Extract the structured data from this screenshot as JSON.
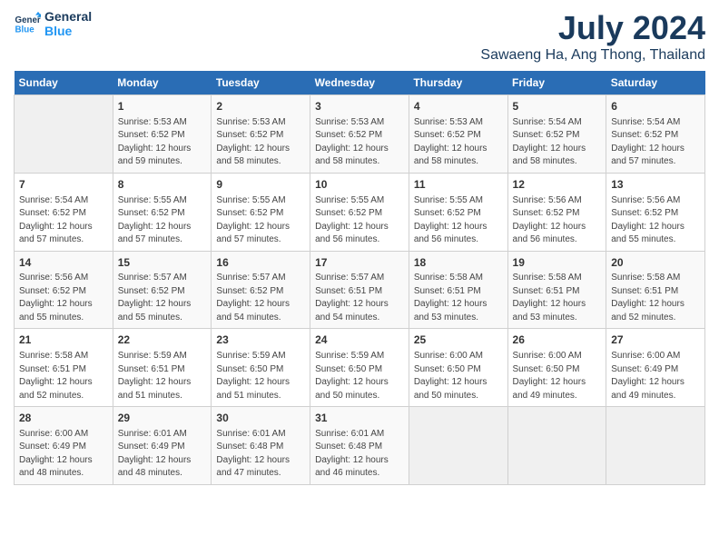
{
  "header": {
    "logo_line1": "General",
    "logo_line2": "Blue",
    "month_year": "July 2024",
    "location": "Sawaeng Ha, Ang Thong, Thailand"
  },
  "days_of_week": [
    "Sunday",
    "Monday",
    "Tuesday",
    "Wednesday",
    "Thursday",
    "Friday",
    "Saturday"
  ],
  "weeks": [
    [
      {
        "day": "",
        "info": ""
      },
      {
        "day": "1",
        "info": "Sunrise: 5:53 AM\nSunset: 6:52 PM\nDaylight: 12 hours\nand 59 minutes."
      },
      {
        "day": "2",
        "info": "Sunrise: 5:53 AM\nSunset: 6:52 PM\nDaylight: 12 hours\nand 58 minutes."
      },
      {
        "day": "3",
        "info": "Sunrise: 5:53 AM\nSunset: 6:52 PM\nDaylight: 12 hours\nand 58 minutes."
      },
      {
        "day": "4",
        "info": "Sunrise: 5:53 AM\nSunset: 6:52 PM\nDaylight: 12 hours\nand 58 minutes."
      },
      {
        "day": "5",
        "info": "Sunrise: 5:54 AM\nSunset: 6:52 PM\nDaylight: 12 hours\nand 58 minutes."
      },
      {
        "day": "6",
        "info": "Sunrise: 5:54 AM\nSunset: 6:52 PM\nDaylight: 12 hours\nand 57 minutes."
      }
    ],
    [
      {
        "day": "7",
        "info": "Sunrise: 5:54 AM\nSunset: 6:52 PM\nDaylight: 12 hours\nand 57 minutes."
      },
      {
        "day": "8",
        "info": "Sunrise: 5:55 AM\nSunset: 6:52 PM\nDaylight: 12 hours\nand 57 minutes."
      },
      {
        "day": "9",
        "info": "Sunrise: 5:55 AM\nSunset: 6:52 PM\nDaylight: 12 hours\nand 57 minutes."
      },
      {
        "day": "10",
        "info": "Sunrise: 5:55 AM\nSunset: 6:52 PM\nDaylight: 12 hours\nand 56 minutes."
      },
      {
        "day": "11",
        "info": "Sunrise: 5:55 AM\nSunset: 6:52 PM\nDaylight: 12 hours\nand 56 minutes."
      },
      {
        "day": "12",
        "info": "Sunrise: 5:56 AM\nSunset: 6:52 PM\nDaylight: 12 hours\nand 56 minutes."
      },
      {
        "day": "13",
        "info": "Sunrise: 5:56 AM\nSunset: 6:52 PM\nDaylight: 12 hours\nand 55 minutes."
      }
    ],
    [
      {
        "day": "14",
        "info": "Sunrise: 5:56 AM\nSunset: 6:52 PM\nDaylight: 12 hours\nand 55 minutes."
      },
      {
        "day": "15",
        "info": "Sunrise: 5:57 AM\nSunset: 6:52 PM\nDaylight: 12 hours\nand 55 minutes."
      },
      {
        "day": "16",
        "info": "Sunrise: 5:57 AM\nSunset: 6:52 PM\nDaylight: 12 hours\nand 54 minutes."
      },
      {
        "day": "17",
        "info": "Sunrise: 5:57 AM\nSunset: 6:51 PM\nDaylight: 12 hours\nand 54 minutes."
      },
      {
        "day": "18",
        "info": "Sunrise: 5:58 AM\nSunset: 6:51 PM\nDaylight: 12 hours\nand 53 minutes."
      },
      {
        "day": "19",
        "info": "Sunrise: 5:58 AM\nSunset: 6:51 PM\nDaylight: 12 hours\nand 53 minutes."
      },
      {
        "day": "20",
        "info": "Sunrise: 5:58 AM\nSunset: 6:51 PM\nDaylight: 12 hours\nand 52 minutes."
      }
    ],
    [
      {
        "day": "21",
        "info": "Sunrise: 5:58 AM\nSunset: 6:51 PM\nDaylight: 12 hours\nand 52 minutes."
      },
      {
        "day": "22",
        "info": "Sunrise: 5:59 AM\nSunset: 6:51 PM\nDaylight: 12 hours\nand 51 minutes."
      },
      {
        "day": "23",
        "info": "Sunrise: 5:59 AM\nSunset: 6:50 PM\nDaylight: 12 hours\nand 51 minutes."
      },
      {
        "day": "24",
        "info": "Sunrise: 5:59 AM\nSunset: 6:50 PM\nDaylight: 12 hours\nand 50 minutes."
      },
      {
        "day": "25",
        "info": "Sunrise: 6:00 AM\nSunset: 6:50 PM\nDaylight: 12 hours\nand 50 minutes."
      },
      {
        "day": "26",
        "info": "Sunrise: 6:00 AM\nSunset: 6:50 PM\nDaylight: 12 hours\nand 49 minutes."
      },
      {
        "day": "27",
        "info": "Sunrise: 6:00 AM\nSunset: 6:49 PM\nDaylight: 12 hours\nand 49 minutes."
      }
    ],
    [
      {
        "day": "28",
        "info": "Sunrise: 6:00 AM\nSunset: 6:49 PM\nDaylight: 12 hours\nand 48 minutes."
      },
      {
        "day": "29",
        "info": "Sunrise: 6:01 AM\nSunset: 6:49 PM\nDaylight: 12 hours\nand 48 minutes."
      },
      {
        "day": "30",
        "info": "Sunrise: 6:01 AM\nSunset: 6:48 PM\nDaylight: 12 hours\nand 47 minutes."
      },
      {
        "day": "31",
        "info": "Sunrise: 6:01 AM\nSunset: 6:48 PM\nDaylight: 12 hours\nand 46 minutes."
      },
      {
        "day": "",
        "info": ""
      },
      {
        "day": "",
        "info": ""
      },
      {
        "day": "",
        "info": ""
      }
    ]
  ]
}
